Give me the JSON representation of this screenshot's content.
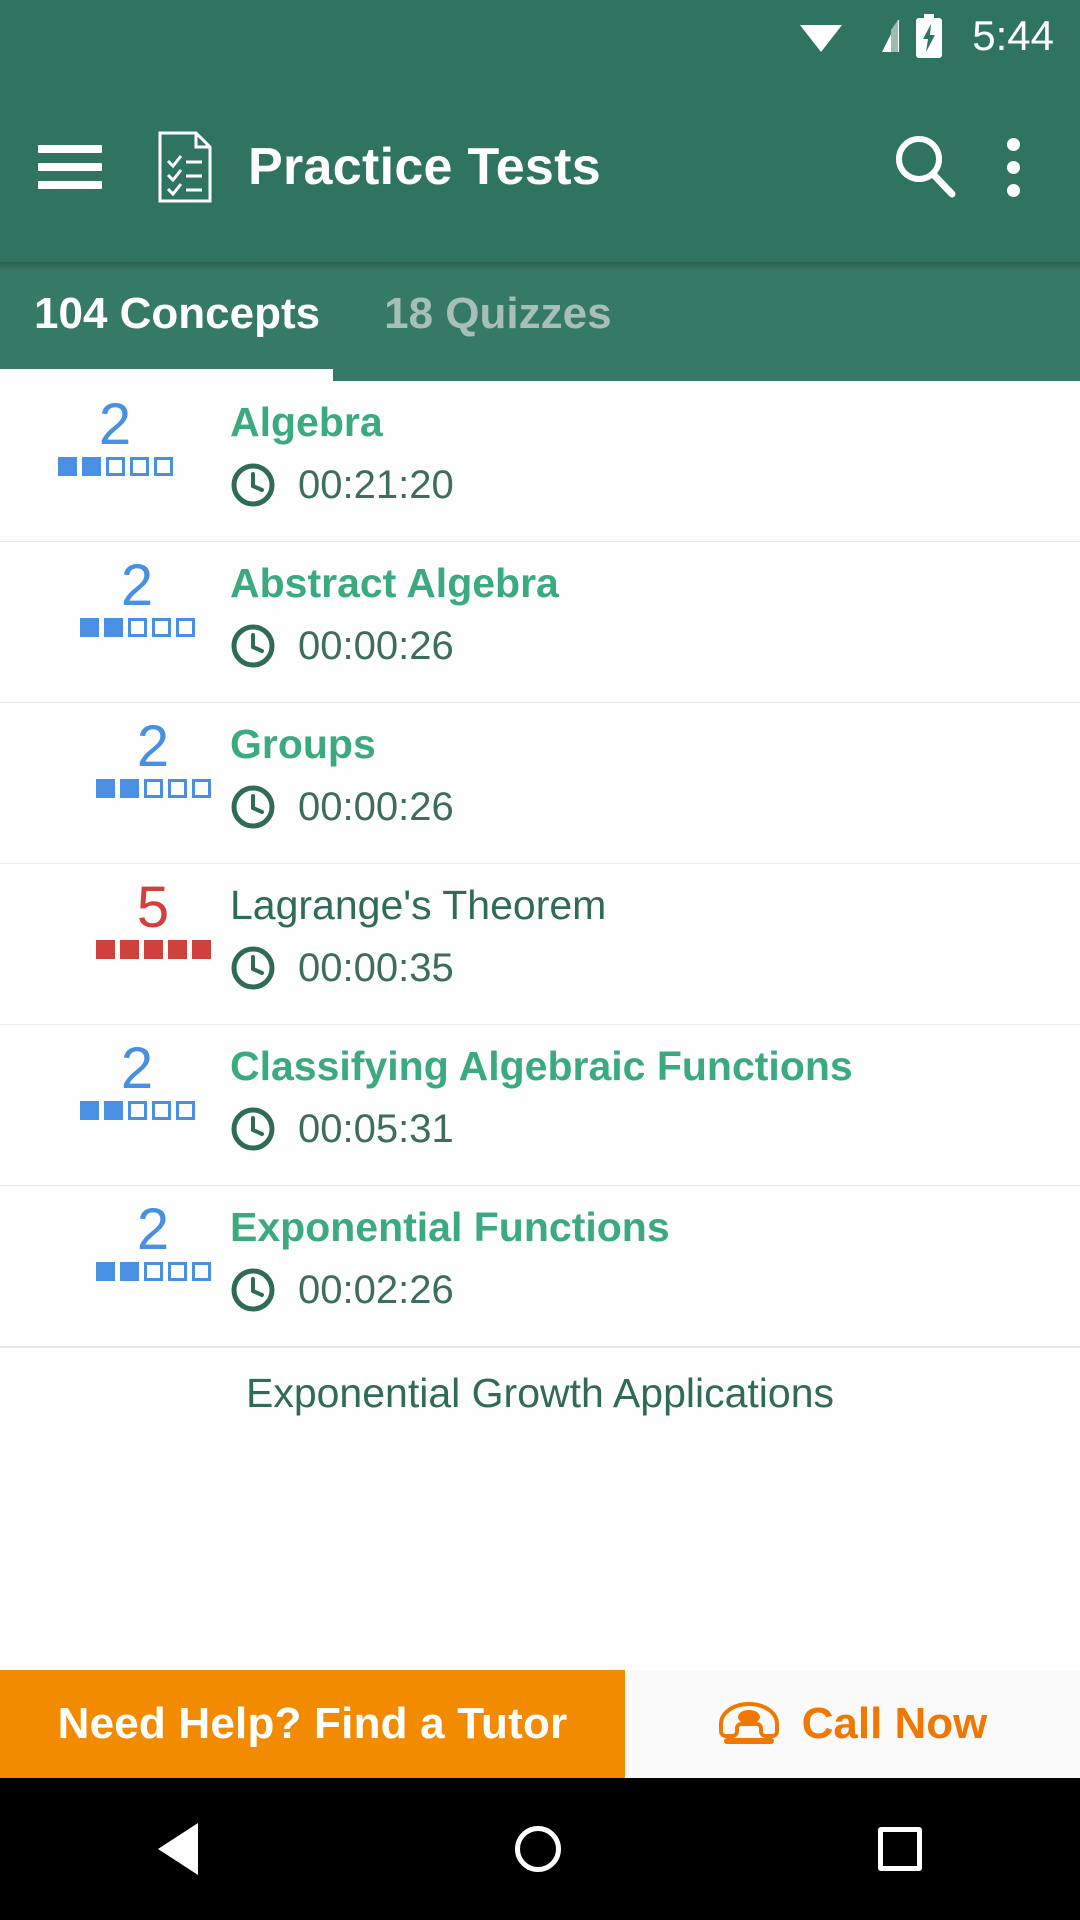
{
  "status_bar": {
    "time": "5:44",
    "icons": [
      "wifi-icon",
      "signal-icon",
      "battery-charging-icon"
    ]
  },
  "toolbar": {
    "menu_icon": "hamburger-menu-icon",
    "app_icon": "document-checklist-icon",
    "title": "Practice Tests",
    "search_icon": "search-icon",
    "overflow_icon": "more-vertical-icon"
  },
  "tabs": [
    {
      "label": "104 Concepts",
      "selected": true
    },
    {
      "label": "18 Quizzes",
      "selected": false
    }
  ],
  "colors": {
    "toolbar_green": "#2F7461",
    "tabbar_green": "#357A66",
    "title_green": "#3BAA7F",
    "time_green": "#3C6E5B",
    "difficulty_blue": "#4A90E2",
    "difficulty_red": "#D0403C",
    "banner_orange": "#F38B00",
    "call_orange": "#F07800"
  },
  "list": {
    "items": [
      {
        "difficulty": "2",
        "difficulty_filled": 2,
        "difficulty_total": 5,
        "difficulty_color": "blue",
        "title": "Algebra",
        "title_style": "bold",
        "time": "00:21:20",
        "clock_icon": "clock-icon"
      },
      {
        "difficulty": "2",
        "difficulty_filled": 2,
        "difficulty_total": 5,
        "difficulty_color": "blue",
        "title": "Abstract Algebra",
        "title_style": "bold",
        "time": "00:00:26",
        "clock_icon": "clock-icon"
      },
      {
        "difficulty": "2",
        "difficulty_filled": 2,
        "difficulty_total": 5,
        "difficulty_color": "blue",
        "title": "Groups",
        "title_style": "bold",
        "time": "00:00:26",
        "clock_icon": "clock-icon"
      },
      {
        "difficulty": "5",
        "difficulty_filled": 5,
        "difficulty_total": 5,
        "difficulty_color": "red",
        "title": "Lagrange's Theorem",
        "title_style": "plain",
        "time": "00:00:35",
        "clock_icon": "clock-icon"
      },
      {
        "difficulty": "2",
        "difficulty_filled": 2,
        "difficulty_total": 5,
        "difficulty_color": "blue",
        "title": "Classifying Algebraic Functions",
        "title_style": "bold",
        "time": "00:05:31",
        "clock_icon": "clock-icon"
      },
      {
        "difficulty": "2",
        "difficulty_filled": 2,
        "difficulty_total": 5,
        "difficulty_color": "blue",
        "title": "Exponential Functions",
        "title_style": "bold",
        "time": "00:02:26",
        "clock_icon": "clock-icon"
      }
    ],
    "partial_item": {
      "title": "Exponential Growth Applications"
    }
  },
  "banner": {
    "main_label": "Need Help? Find a Tutor",
    "phone_icon": "phone-icon",
    "call_label": "Call Now"
  },
  "nav_bar": {
    "back_icon": "back-triangle-icon",
    "home_icon": "home-circle-icon",
    "recents_icon": "recents-square-icon"
  }
}
